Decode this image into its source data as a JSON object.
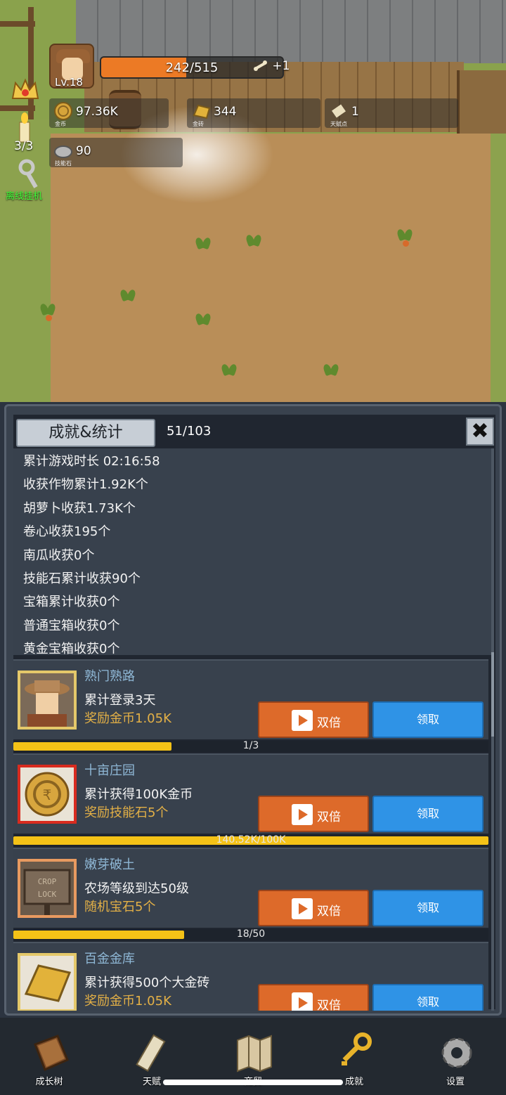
{
  "hud": {
    "level": "Lv.18",
    "xp_text": "242/515",
    "xp_fraction": 0.47,
    "talent_plus": "+1",
    "gold_value": "97.36K",
    "gold_label": "金币",
    "goldbar_value": "344",
    "goldbar_label": "金砖",
    "talent_value": "1",
    "talent_label": "天赋点",
    "skillstone_value": "90",
    "skillstone_label": "技能石",
    "candle_count": "3/3",
    "idle_label": "离线挂机"
  },
  "panel": {
    "title": "成就&统计",
    "counter": "51/103",
    "close_icon": "close-icon",
    "stats": [
      "累计游戏时长 02:16:58",
      "收获作物累计1.92K个",
      "胡萝卜收获1.73K个",
      "卷心收获195个",
      "南瓜收获0个",
      "技能石累计收获90个",
      "宝箱累计收获0个",
      "普通宝箱收获0个",
      "黄金宝箱收获0个"
    ],
    "achievements": [
      {
        "name": "熟门熟路",
        "desc": "累计登录3天",
        "reward": "奖励金币1.05K",
        "double": "双倍",
        "claim": "领取",
        "progress_text": "1/3",
        "progress": 0.333,
        "icon": "farmer-avatar-icon"
      },
      {
        "name": "十亩庄园",
        "desc": "累计获得100K金币",
        "reward": "奖励技能石5个",
        "double": "双倍",
        "claim": "领取",
        "progress_text": "140.52K/100K",
        "progress": 1.0,
        "icon": "gold-coin-icon"
      },
      {
        "name": "嫩芽破土",
        "desc": "农场等级到达50级",
        "reward": "随机宝石5个",
        "double": "双倍",
        "claim": "领取",
        "progress_text": "18/50",
        "progress": 0.36,
        "icon": "crop-lock-icon"
      },
      {
        "name": "百金金库",
        "desc": "累计获得500个大金砖",
        "reward": "奖励金币1.05K",
        "double": "双倍",
        "claim": "领取",
        "progress_text": "",
        "progress": 0,
        "icon": "gold-bar-icon"
      }
    ]
  },
  "nav": [
    {
      "label": "成长树",
      "icon": "book-icon"
    },
    {
      "label": "天赋",
      "icon": "scroll-icon"
    },
    {
      "label": "商贸",
      "icon": "map-icon"
    },
    {
      "label": "成就",
      "icon": "key-icon"
    },
    {
      "label": "设置",
      "icon": "gear-icon"
    }
  ],
  "colors": {
    "accent_orange": "#dd6a2a",
    "accent_blue": "#2f93e6",
    "progress_yellow": "#f4c217",
    "reward_gold": "#e3b046",
    "name_blue": "#8fb8d6"
  }
}
